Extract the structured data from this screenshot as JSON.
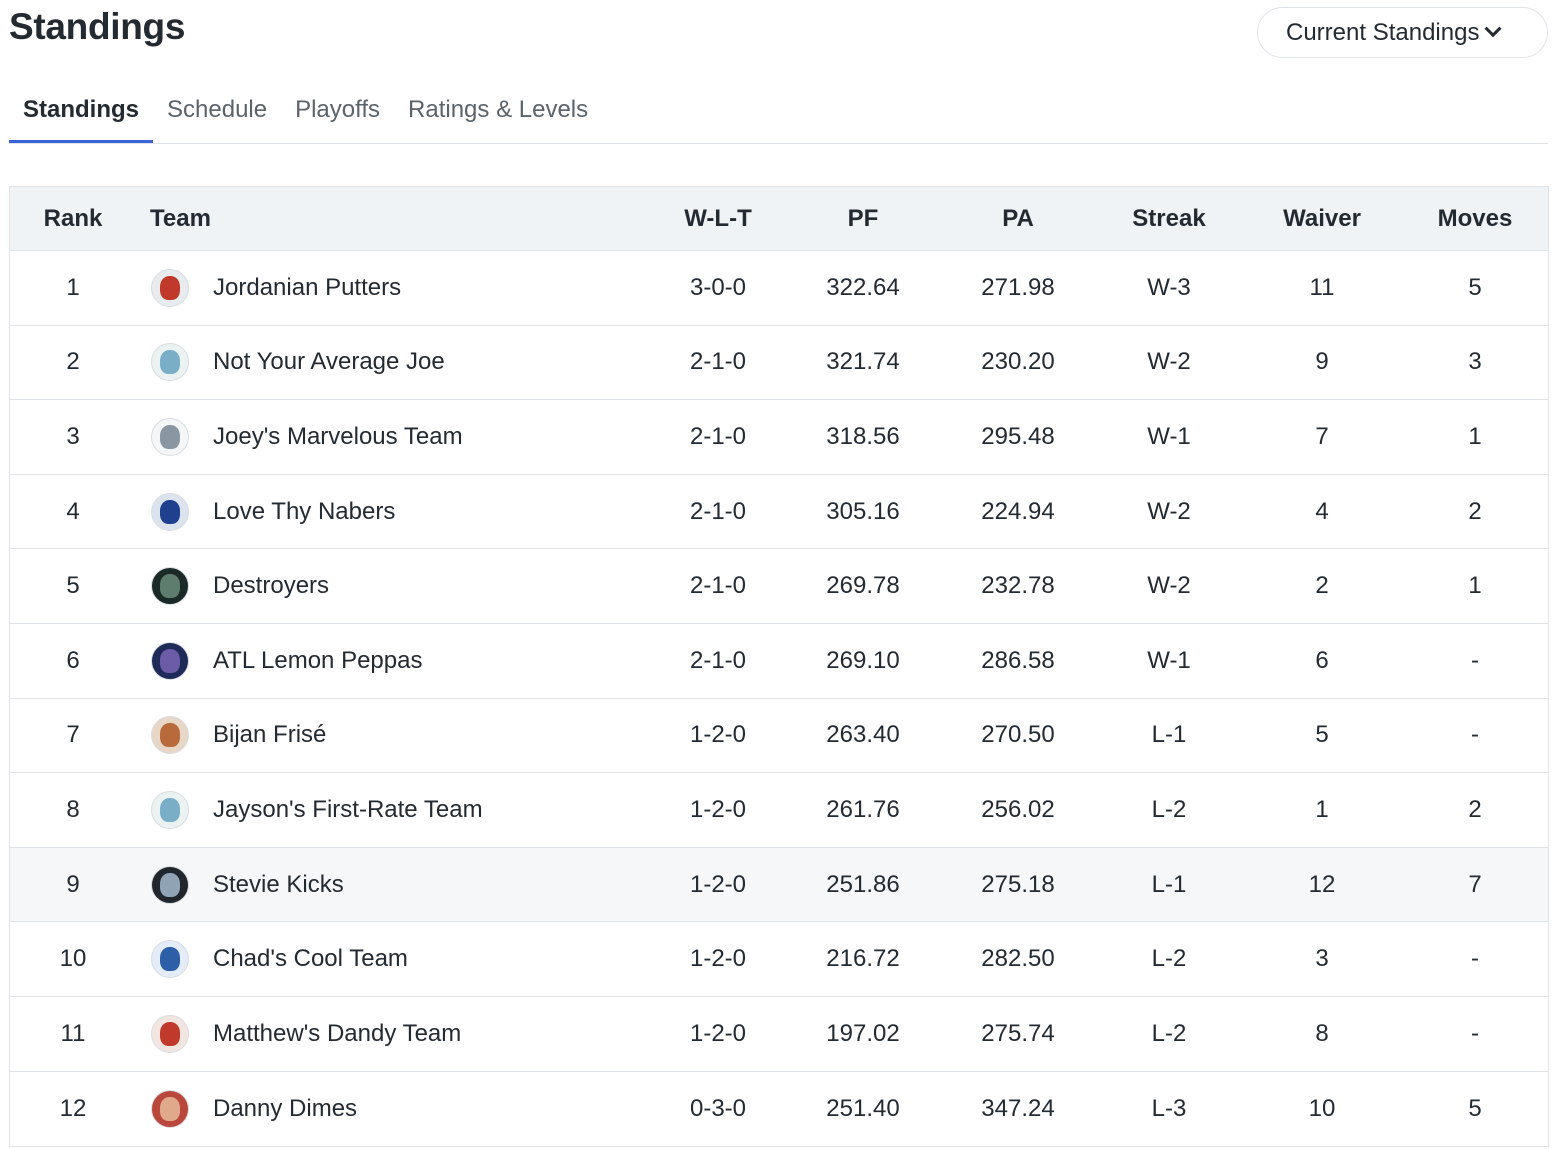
{
  "header": {
    "title": "Standings",
    "view_select": "Current Standings"
  },
  "tabs": [
    {
      "label": "Standings",
      "active": true
    },
    {
      "label": "Schedule",
      "active": false
    },
    {
      "label": "Playoffs",
      "active": false
    },
    {
      "label": "Ratings & Levels",
      "active": false
    }
  ],
  "table": {
    "columns": {
      "rank": "Rank",
      "team": "Team",
      "wlt": "W-L-T",
      "pf": "PF",
      "pa": "PA",
      "streak": "Streak",
      "waiver": "Waiver",
      "moves": "Moves"
    },
    "rows": [
      {
        "rank": "1",
        "team": "Jordanian Putters",
        "wlt": "3-0-0",
        "pf": "322.64",
        "pa": "271.98",
        "streak": "W-3",
        "waiver": "11",
        "moves": "5",
        "avatar_bg": "#e9ecef",
        "avatar_fg": "#c0392b",
        "avatar_icon": "team-logo-icon"
      },
      {
        "rank": "2",
        "team": "Not Your Average Joe",
        "wlt": "2-1-0",
        "pf": "321.74",
        "pa": "230.20",
        "streak": "W-2",
        "waiver": "9",
        "moves": "3",
        "avatar_bg": "#eaf3f2",
        "avatar_fg": "#7aaec7",
        "avatar_icon": "team-logo-icon"
      },
      {
        "rank": "3",
        "team": "Joey's Marvelous Team",
        "wlt": "2-1-0",
        "pf": "318.56",
        "pa": "295.48",
        "streak": "W-1",
        "waiver": "7",
        "moves": "1",
        "avatar_bg": "#f4f6f8",
        "avatar_fg": "#8a97a3",
        "avatar_icon": "shark-icon"
      },
      {
        "rank": "4",
        "team": "Love Thy Nabers",
        "wlt": "2-1-0",
        "pf": "305.16",
        "pa": "224.94",
        "streak": "W-2",
        "waiver": "4",
        "moves": "2",
        "avatar_bg": "#dbe3ef",
        "avatar_fg": "#1f3f8f",
        "avatar_icon": "player-photo-icon"
      },
      {
        "rank": "5",
        "team": "Destroyers",
        "wlt": "2-1-0",
        "pf": "269.78",
        "pa": "232.78",
        "streak": "W-2",
        "waiver": "2",
        "moves": "1",
        "avatar_bg": "#1c2a27",
        "avatar_fg": "#5f7d6e",
        "avatar_icon": "team-logo-icon"
      },
      {
        "rank": "6",
        "team": "ATL Lemon Peppas",
        "wlt": "2-1-0",
        "pf": "269.10",
        "pa": "286.58",
        "streak": "W-1",
        "waiver": "6",
        "moves": "-",
        "avatar_bg": "#1e2a57",
        "avatar_fg": "#6c5ba7",
        "avatar_icon": "skyline-icon"
      },
      {
        "rank": "7",
        "team": "Bijan Frisé",
        "wlt": "1-2-0",
        "pf": "263.40",
        "pa": "270.50",
        "streak": "L-1",
        "waiver": "5",
        "moves": "-",
        "avatar_bg": "#e8d7c6",
        "avatar_fg": "#b86a3a",
        "avatar_icon": "dog-icon"
      },
      {
        "rank": "8",
        "team": "Jayson's First-Rate Team",
        "wlt": "1-2-0",
        "pf": "261.76",
        "pa": "256.02",
        "streak": "L-2",
        "waiver": "1",
        "moves": "2",
        "avatar_bg": "#eaf3f2",
        "avatar_fg": "#7aaec7",
        "avatar_icon": "team-logo-icon"
      },
      {
        "rank": "9",
        "team": "Stevie Kicks",
        "wlt": "1-2-0",
        "pf": "251.86",
        "pa": "275.18",
        "streak": "L-1",
        "waiver": "12",
        "moves": "7",
        "avatar_bg": "#20262b",
        "avatar_fg": "#8fa3b5",
        "avatar_icon": "kicks-logo-icon",
        "highlighted": true
      },
      {
        "rank": "10",
        "team": "Chad's Cool Team",
        "wlt": "1-2-0",
        "pf": "216.72",
        "pa": "282.50",
        "streak": "L-2",
        "waiver": "3",
        "moves": "-",
        "avatar_bg": "#e3ecf8",
        "avatar_fg": "#2d5fa8",
        "avatar_icon": "character-icon"
      },
      {
        "rank": "11",
        "team": "Matthew's Dandy Team",
        "wlt": "1-2-0",
        "pf": "197.02",
        "pa": "275.74",
        "streak": "L-2",
        "waiver": "8",
        "moves": "-",
        "avatar_bg": "#f3e6e1",
        "avatar_fg": "#c0392b",
        "avatar_icon": "character-icon"
      },
      {
        "rank": "12",
        "team": "Danny Dimes",
        "wlt": "0-3-0",
        "pf": "251.40",
        "pa": "347.24",
        "streak": "L-3",
        "waiver": "10",
        "moves": "5",
        "avatar_bg": "#b9473b",
        "avatar_fg": "#e0a98c",
        "avatar_icon": "player-photo-icon"
      }
    ]
  }
}
